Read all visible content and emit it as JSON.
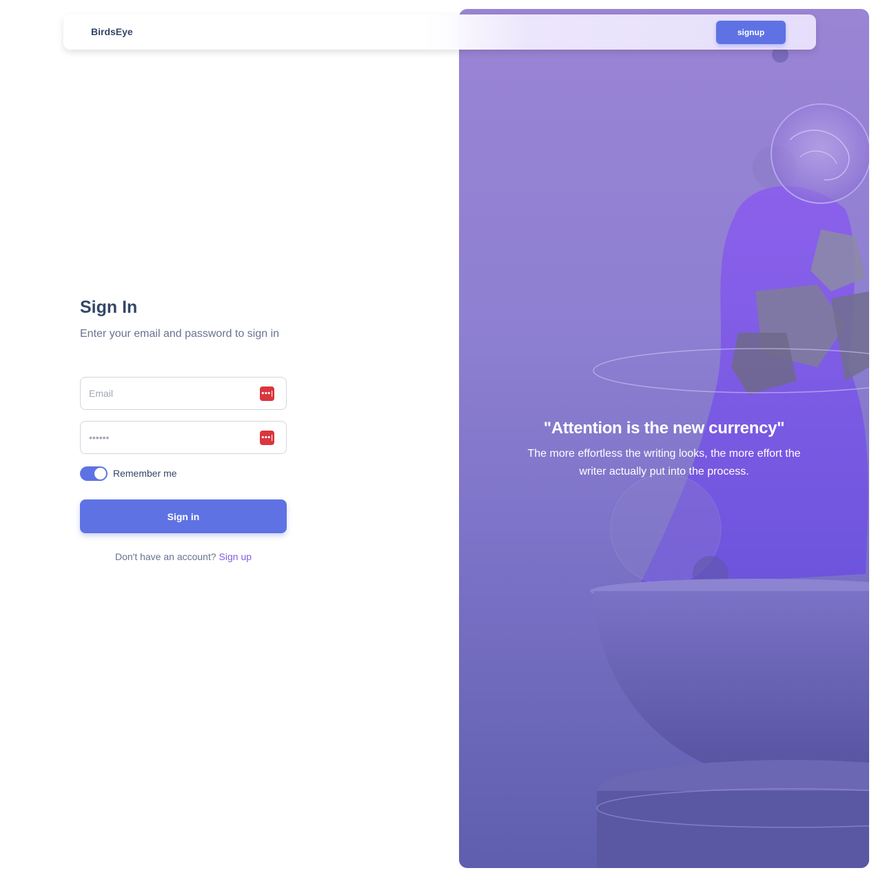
{
  "navbar": {
    "brand": "BirdsEye",
    "signup_label": "signup"
  },
  "signin": {
    "title": "Sign In",
    "subtitle": "Enter your email and password to sign in",
    "email_placeholder": "Email",
    "password_placeholder": "••••••",
    "remember_label": "Remember me",
    "remember_on": true,
    "submit_label": "Sign in",
    "no_account_text": "Don't have an account?",
    "signup_link": "Sign up"
  },
  "hero": {
    "quote": "\"Attention is the new currency\"",
    "text": "The more effortless the writing looks, the more effort the writer actually put into the process."
  },
  "icons": {
    "password_manager": "password-manager-icon"
  },
  "colors": {
    "primary": "#5e72e4",
    "link": "#825ee4",
    "heading": "#344767",
    "muted": "#67748e",
    "password_manager": "#d9363e"
  }
}
